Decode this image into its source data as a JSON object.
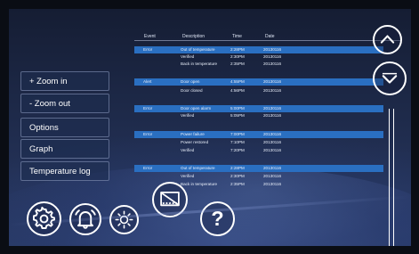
{
  "menu": {
    "items": [
      {
        "label": "+ Zoom in"
      },
      {
        "label": "- Zoom out"
      },
      {
        "label": "Options"
      },
      {
        "label": "Graph"
      },
      {
        "label": "Temperature log"
      }
    ]
  },
  "table": {
    "headers": {
      "event": "Event",
      "description": "Description",
      "time": "Time",
      "date": "Date"
    },
    "rows": [
      {
        "event": "Error",
        "description": "Out of temperature",
        "time": "2:28PM",
        "date": "20130116",
        "highlight": true
      },
      {
        "event": "",
        "description": "Verified",
        "time": "2:30PM",
        "date": "20130116",
        "highlight": false
      },
      {
        "event": "",
        "description": "Back in temperature",
        "time": "2:35PM",
        "date": "20130116",
        "highlight": false
      },
      {
        "event": "Alert",
        "description": "Door open",
        "time": "4:55PM",
        "date": "20130116",
        "highlight": true
      },
      {
        "event": "",
        "description": "Door closed",
        "time": "4:56PM",
        "date": "20130116",
        "highlight": false
      },
      {
        "event": "Error",
        "description": "Door open alarm",
        "time": "5:00PM",
        "date": "20130116",
        "highlight": true
      },
      {
        "event": "",
        "description": "Verified",
        "time": "5:05PM",
        "date": "20130116",
        "highlight": false
      },
      {
        "event": "Error",
        "description": "Power failure",
        "time": "7:00PM",
        "date": "20130116",
        "highlight": true
      },
      {
        "event": "",
        "description": "Power restored",
        "time": "7:10PM",
        "date": "20130116",
        "highlight": false
      },
      {
        "event": "",
        "description": "Verified",
        "time": "7:20PM",
        "date": "20130116",
        "highlight": false
      },
      {
        "event": "Error",
        "description": "Out of temperature",
        "time": "2:28PM",
        "date": "20130116",
        "highlight": true
      },
      {
        "event": "",
        "description": "Verified",
        "time": "2:30PM",
        "date": "20130116",
        "highlight": false
      },
      {
        "event": "",
        "description": "Back in temperature",
        "time": "2:35PM",
        "date": "20130116",
        "highlight": false
      }
    ]
  },
  "toolbar": {
    "buttons": [
      "settings-gear-icon",
      "alarm-bell-icon",
      "brightness-sun-icon",
      "display-screen-icon",
      "help-question-icon"
    ],
    "help_label": "?"
  },
  "scroll": {
    "up": "chevron-up-icon",
    "down": "chevron-down-icon"
  },
  "colors": {
    "highlight": "#2a6fc1",
    "background": "#1e2a4a",
    "foreground": "#ffffff"
  }
}
